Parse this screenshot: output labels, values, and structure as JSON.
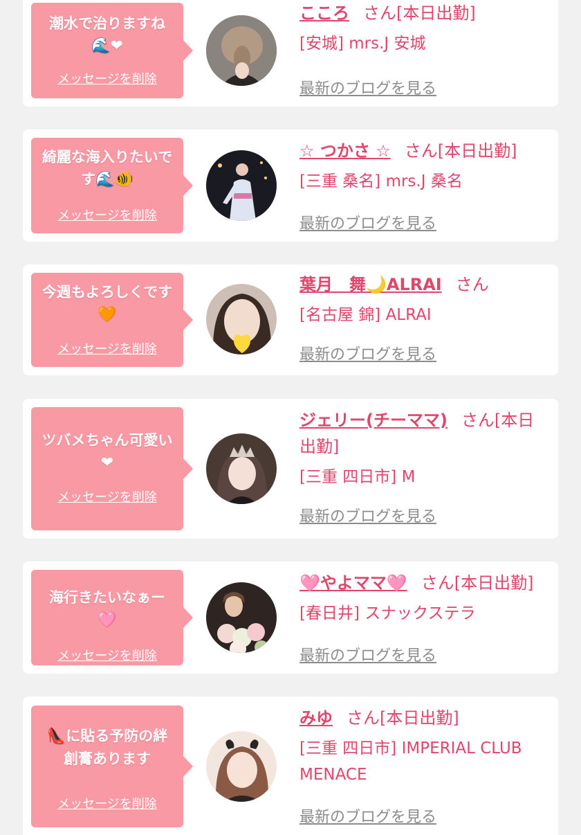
{
  "theme": {
    "accent": "#e0456b",
    "bubble": "#f999a4",
    "background": "#f1f1f1",
    "link_gray": "#8c8c8c"
  },
  "common": {
    "delete_label": "メッセージを削除",
    "blog_label": "最新のブログを見る"
  },
  "entries": [
    {
      "message": "潮水で治りますね",
      "message_icons": [
        "wave-icon",
        "heart-icon"
      ],
      "message_emoji": "🌊❤",
      "name": "こころ",
      "suffix": "さん[本日出勤]",
      "shop": "[安城] mrs.J 安城",
      "avatar": "avatar-hair-back"
    },
    {
      "message": "綺麗な海入りたいです",
      "message_icons": [
        "wave-icon",
        "fish-icon"
      ],
      "message_emoji": "🌊🐠",
      "name": "☆ つかさ ☆",
      "suffix": "さん[本日出勤]",
      "shop": "[三重 桑名] mrs.J 桑名",
      "avatar": "avatar-yukata"
    },
    {
      "message": "今週もよろしくです",
      "message_icons": [
        "heart-icon"
      ],
      "message_emoji": "🧡",
      "name": "葉月　舞🌙ALRAI",
      "suffix": "さん",
      "shop": "[名古屋 錦] ALRAI",
      "avatar": "avatar-heart-face"
    },
    {
      "message": "ツバメちゃん可愛い",
      "message_icons": [
        "heart-icon"
      ],
      "message_emoji": "❤",
      "name": "ジェリー(チーママ)",
      "suffix": "さん[本日出勤]",
      "shop": "[三重 四日市] M",
      "avatar": "avatar-tiara"
    },
    {
      "message": "海行きたいなぁー",
      "message_icons": [
        "pink-heart-icon"
      ],
      "message_emoji": "🩷",
      "name": "🩷やよママ🩷",
      "suffix": "さん[本日出勤]",
      "shop": "[春日井] スナックステラ",
      "avatar": "avatar-flowers"
    },
    {
      "message": "に貼る予防の絆創膏あります",
      "message_icons": [
        "heel-icon"
      ],
      "message_emoji": "👠",
      "name": "みゆ",
      "suffix": "さん[本日出勤]",
      "shop": "[三重 四日市] IMPERIAL CLUB MENACE",
      "avatar": "avatar-bow"
    }
  ]
}
